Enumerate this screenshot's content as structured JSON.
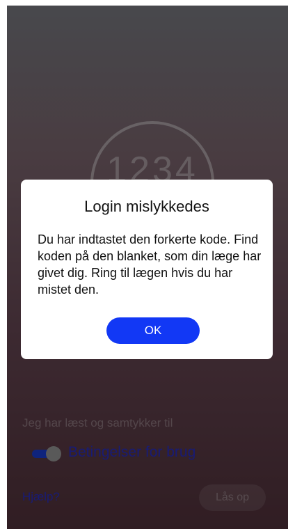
{
  "code_display": {
    "digits": "1234"
  },
  "consent": {
    "text": "Jeg har læst og samtykker til",
    "terms_link": "Betingelser for brug",
    "toggle_on": true
  },
  "footer": {
    "help_link": "Hjælp?",
    "unlock_button": "Lås op"
  },
  "dialog": {
    "title": "Login mislykkedes",
    "message": "Du har indtastet den forkerte kode. Find koden på den blanket, som din læge har givet dig. Ring til lægen hvis du har mistet den.",
    "ok_button": "OK"
  },
  "colors": {
    "accent": "#1238f5",
    "link": "#2a2fc9"
  }
}
